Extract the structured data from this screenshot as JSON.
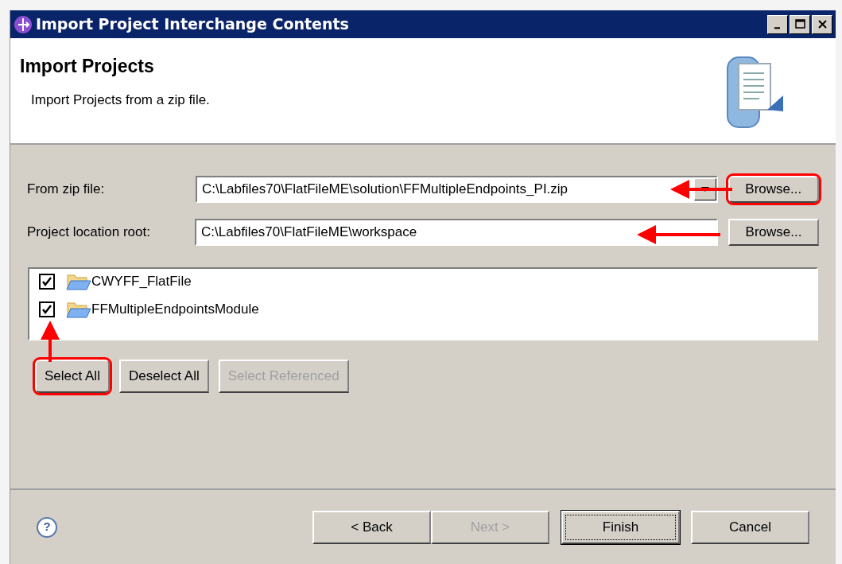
{
  "window": {
    "title": "Import Project Interchange Contents",
    "controls": [
      {
        "kind": "minimize"
      },
      {
        "kind": "maximize"
      },
      {
        "kind": "close"
      }
    ]
  },
  "header": {
    "title": "Import Projects",
    "description": "Import Projects from a zip file."
  },
  "fields": [
    {
      "kind": "combo",
      "label": "From zip file:",
      "value": "C:\\Labfiles70\\FlatFileME\\solution\\FFMultipleEndpoints_PI.zip",
      "button": {
        "label": "Browse...",
        "highlighted": true
      }
    },
    {
      "kind": "text",
      "label": "Project location root:",
      "value": "C:\\Labfiles70\\FlatFileME\\workspace",
      "button": {
        "label": "Browse...",
        "highlighted": false
      }
    }
  ],
  "projects": [
    {
      "name": "CWYFF_FlatFile",
      "checked": true
    },
    {
      "name": "FFMultipleEndpointsModule",
      "checked": true
    }
  ],
  "selection_buttons": [
    {
      "label": "Select All",
      "disabled": false,
      "highlighted": true
    },
    {
      "label": "Deselect All",
      "disabled": false,
      "highlighted": false
    },
    {
      "label": "Select Referenced",
      "disabled": true,
      "highlighted": false
    }
  ],
  "footer_buttons": [
    {
      "label": "< Back",
      "disabled": false,
      "default": false
    },
    {
      "label": "Next >",
      "disabled": true,
      "default": false
    },
    {
      "label": "Finish",
      "disabled": false,
      "default": true
    },
    {
      "label": "Cancel",
      "disabled": false,
      "default": false
    }
  ],
  "help_button": "?"
}
